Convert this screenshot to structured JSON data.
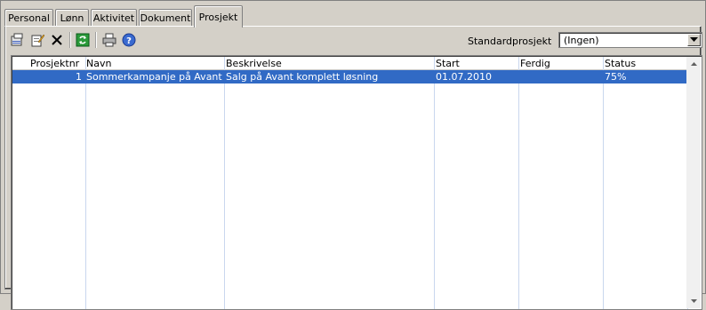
{
  "tabs": [
    {
      "label": "Personal",
      "active": false
    },
    {
      "label": "Lønn",
      "active": false
    },
    {
      "label": "Aktivitet",
      "active": false
    },
    {
      "label": "Dokument",
      "active": false
    },
    {
      "label": "Prosjekt",
      "active": true
    }
  ],
  "toolbar": {
    "icons": [
      "new-document-icon",
      "edit-icon",
      "delete-icon",
      "refresh-icon",
      "print-icon",
      "help-icon"
    ],
    "standard_label": "Standardprosjekt",
    "standard_value": "(Ingen)"
  },
  "table": {
    "columns": [
      "Prosjektnr",
      "Navn",
      "Beskrivelse",
      "Start",
      "Ferdig",
      "Status"
    ],
    "rows": [
      {
        "nr": "1",
        "navn": "Sommerkampanje på Avant",
        "beskrivelse": "Salg på Avant komplett løsning",
        "start": "01.07.2010",
        "ferdig": "",
        "status": "75%"
      }
    ]
  },
  "colors": {
    "selection": "#316ac5",
    "window": "#d4d0c8"
  }
}
